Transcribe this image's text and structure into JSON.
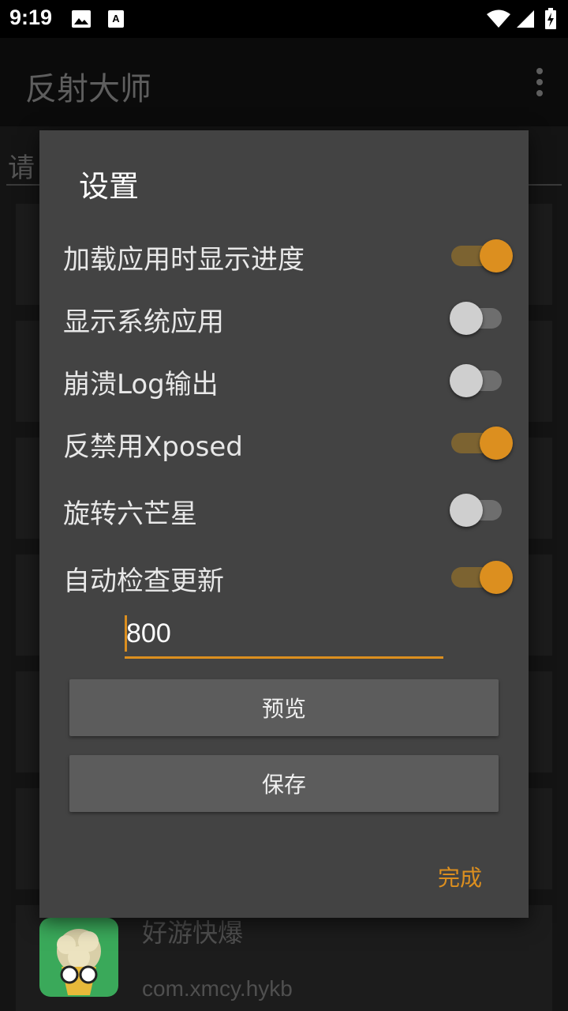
{
  "status_bar": {
    "time": "9:19",
    "icons": [
      "image-icon",
      "a-notification-icon",
      "wifi-icon",
      "signal-icon",
      "battery-charging-icon"
    ]
  },
  "app_bar": {
    "title": "反射大师",
    "overflow_icon": "more-vert-icon"
  },
  "background": {
    "search_partial": "请",
    "last_app": {
      "name": "好游快爆",
      "package": "com.xmcy.hykb"
    }
  },
  "dialog": {
    "title": "设置",
    "settings": [
      {
        "label": "加载应用时显示进度",
        "on": true
      },
      {
        "label": "显示系统应用",
        "on": false
      },
      {
        "label": "崩溃Log输出",
        "on": false
      },
      {
        "label": "反禁用Xposed",
        "on": true
      },
      {
        "label": "旋转六芒星",
        "on": false
      },
      {
        "label": "自动检查更新",
        "on": true
      }
    ],
    "input_value": "800",
    "preview_button": "预览",
    "save_button": "保存",
    "done_button": "完成"
  },
  "colors": {
    "accent": "#dc8f1f",
    "dialog_bg": "#434343",
    "button_bg": "#5c5c5c"
  }
}
